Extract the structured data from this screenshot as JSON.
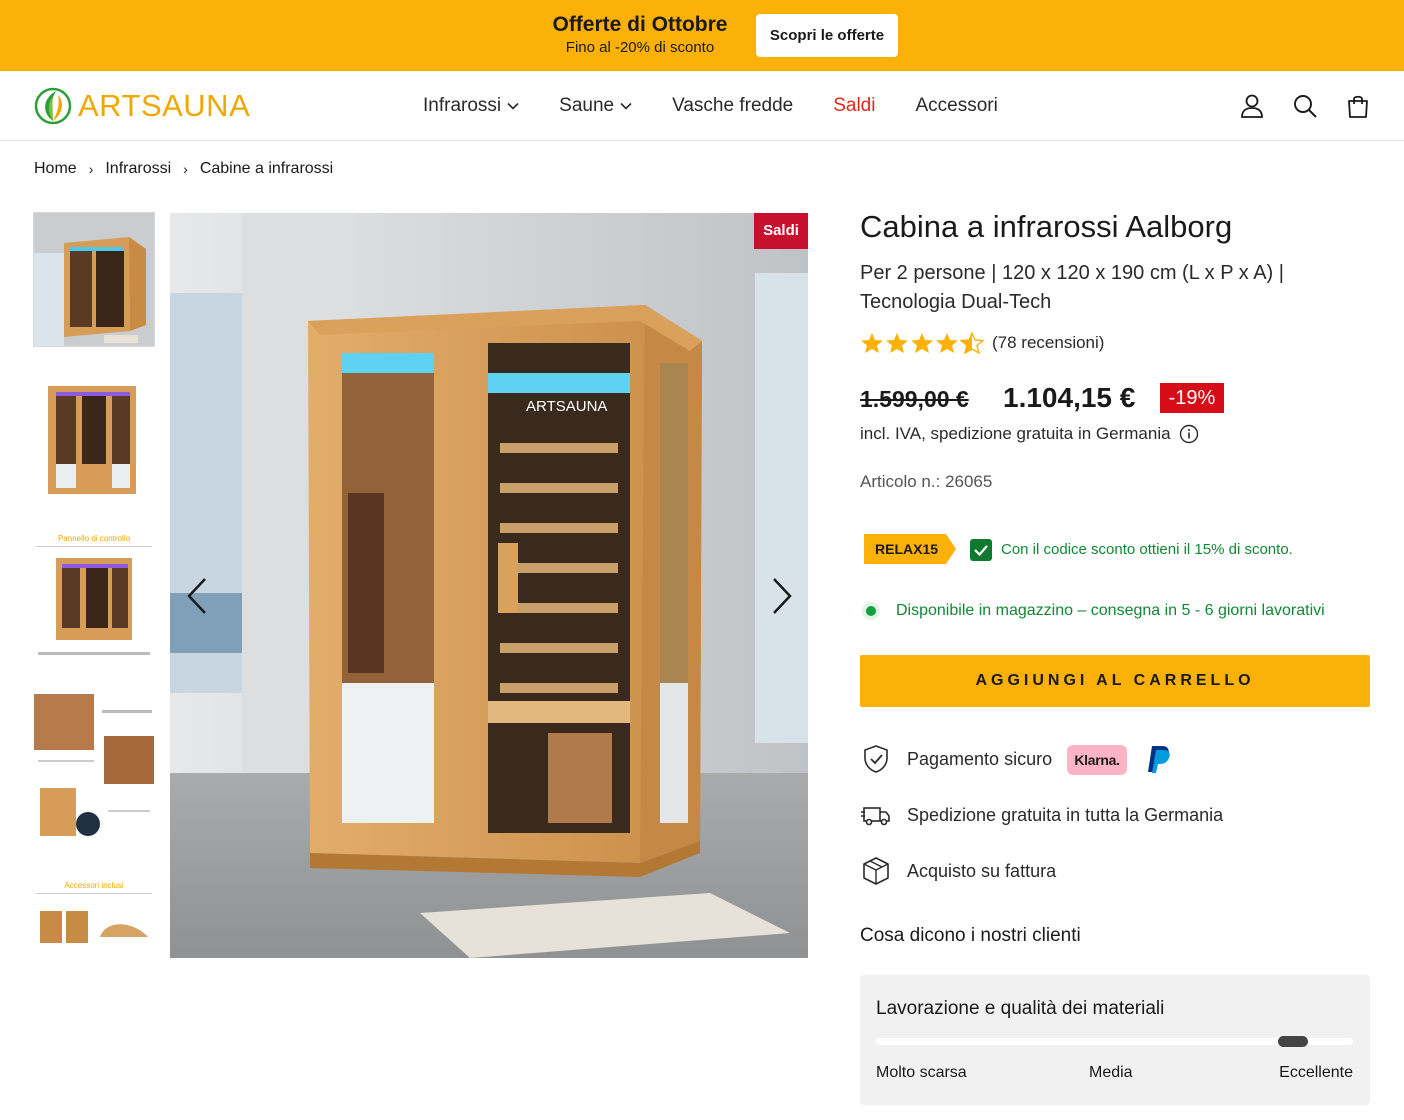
{
  "promo": {
    "title": "Offerte di Ottobre",
    "subtitle": "Fino al -20% di sconto",
    "button": "Scopri le offerte",
    "background": "#fbb107"
  },
  "header": {
    "logo_text": "ARTSAUNA",
    "nav": [
      {
        "label": "Infrarossi",
        "has_dropdown": true
      },
      {
        "label": "Saune",
        "has_dropdown": true
      },
      {
        "label": "Vasche fredde",
        "has_dropdown": false
      },
      {
        "label": "Saldi",
        "has_dropdown": false,
        "highlight": "#e3261b"
      },
      {
        "label": "Accessori",
        "has_dropdown": false
      }
    ],
    "icons": [
      "account-icon",
      "search-icon",
      "cart-icon"
    ]
  },
  "breadcrumb": [
    "Home",
    "Infrarossi",
    "Cabine a infrarossi"
  ],
  "gallery": {
    "thumbnails": [
      "thumb-1",
      "thumb-2",
      "thumb-3",
      "thumb-4",
      "thumb-5"
    ],
    "thumb_captions": [
      "Pannello di controllo",
      "Accessori inclusi"
    ],
    "active_index": 0,
    "badge": "Saldi",
    "image_brand": "ARTSAUNA"
  },
  "product": {
    "title": "Cabina a infrarossi Aalborg",
    "subtitle": "Per 2 persone | 120 x 120 x 190 cm (L x P x A) | Tecnologia Dual-Tech",
    "rating": 4.5,
    "reviews": "(78 recensioni)",
    "price_old": "1.599,00 €",
    "price_new": "1.104,15 €",
    "discount": "-19%",
    "vat_note": "incl. IVA, spedizione gratuita in Germania",
    "sku": "Articolo n.: 26065",
    "promo_code": "RELAX15",
    "promo_message": "Con il codice sconto ottieni il 15% di sconto.",
    "stock": "Disponibile in magazzino – consegna in 5 - 6 giorni lavorativi",
    "add_to_cart": "AGGIUNGI AL CARRELLO"
  },
  "features": {
    "payment": "Pagamento sicuro",
    "klarna": "Klarna.",
    "shipping": "Spedizione gratuita in tutta la Germania",
    "invoice": "Acquisto su fattura"
  },
  "customer_reviews": {
    "title": "Cosa dicono i nostri clienti",
    "card_title": "Lavorazione e qualità dei materiali",
    "level": 0.9,
    "labels": [
      "Molto scarsa",
      "Media",
      "Eccellente"
    ]
  },
  "colors": {
    "accent": "#fbb107",
    "sale_red": "#c8102e",
    "success_green": "#118834"
  }
}
